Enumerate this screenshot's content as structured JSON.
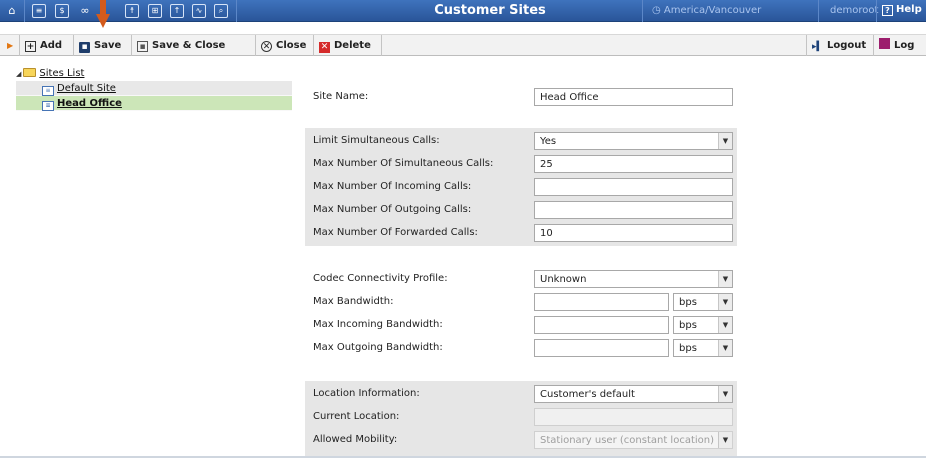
{
  "header": {
    "title": "Customer Sites",
    "timezone": "America/Vancouver",
    "user": "demoroot",
    "help_label": "Help",
    "nav_icons": [
      "home-icon",
      "list-icon",
      "dollar-icon",
      "binoculars-icon",
      "person-icon",
      "network-icon",
      "upload-icon",
      "chart-icon",
      "search-icon"
    ]
  },
  "toolbar": {
    "add": "Add",
    "save": "Save",
    "save_close": "Save & Close",
    "close": "Close",
    "delete": "Delete",
    "logout": "Logout",
    "log": "Log"
  },
  "tree": {
    "root": "Sites List",
    "items": [
      {
        "label": "Default Site",
        "active": false
      },
      {
        "label": "Head Office",
        "active": true
      }
    ]
  },
  "form": {
    "site_name": {
      "label": "Site Name:",
      "value": "Head Office"
    },
    "limits": {
      "limit_simultaneous": {
        "label": "Limit Simultaneous Calls:",
        "value": "Yes"
      },
      "max_simultaneous": {
        "label": "Max Number Of Simultaneous Calls:",
        "value": "25"
      },
      "max_incoming": {
        "label": "Max Number Of Incoming Calls:",
        "value": ""
      },
      "max_outgoing": {
        "label": "Max Number Of Outgoing Calls:",
        "value": ""
      },
      "max_forwarded": {
        "label": "Max Number Of Forwarded Calls:",
        "value": "10"
      }
    },
    "bandwidth": {
      "codec_profile": {
        "label": "Codec Connectivity Profile:",
        "value": "Unknown"
      },
      "max_bandwidth": {
        "label": "Max Bandwidth:",
        "value": "",
        "unit": "bps"
      },
      "max_incoming_bw": {
        "label": "Max Incoming Bandwidth:",
        "value": "",
        "unit": "bps"
      },
      "max_outgoing_bw": {
        "label": "Max Outgoing Bandwidth:",
        "value": "",
        "unit": "bps"
      }
    },
    "location": {
      "location_info": {
        "label": "Location Information:",
        "value": "Customer's default"
      },
      "current_location": {
        "label": "Current Location:",
        "value": ""
      },
      "allowed_mobility": {
        "label": "Allowed Mobility:",
        "value": "Stationary user (constant location)"
      }
    }
  },
  "colors": {
    "topbar": "#2a5599",
    "active_row": "#cce6b8",
    "shaded_group": "#e6e6e6",
    "pointer_arrow": "#d35b1d"
  }
}
